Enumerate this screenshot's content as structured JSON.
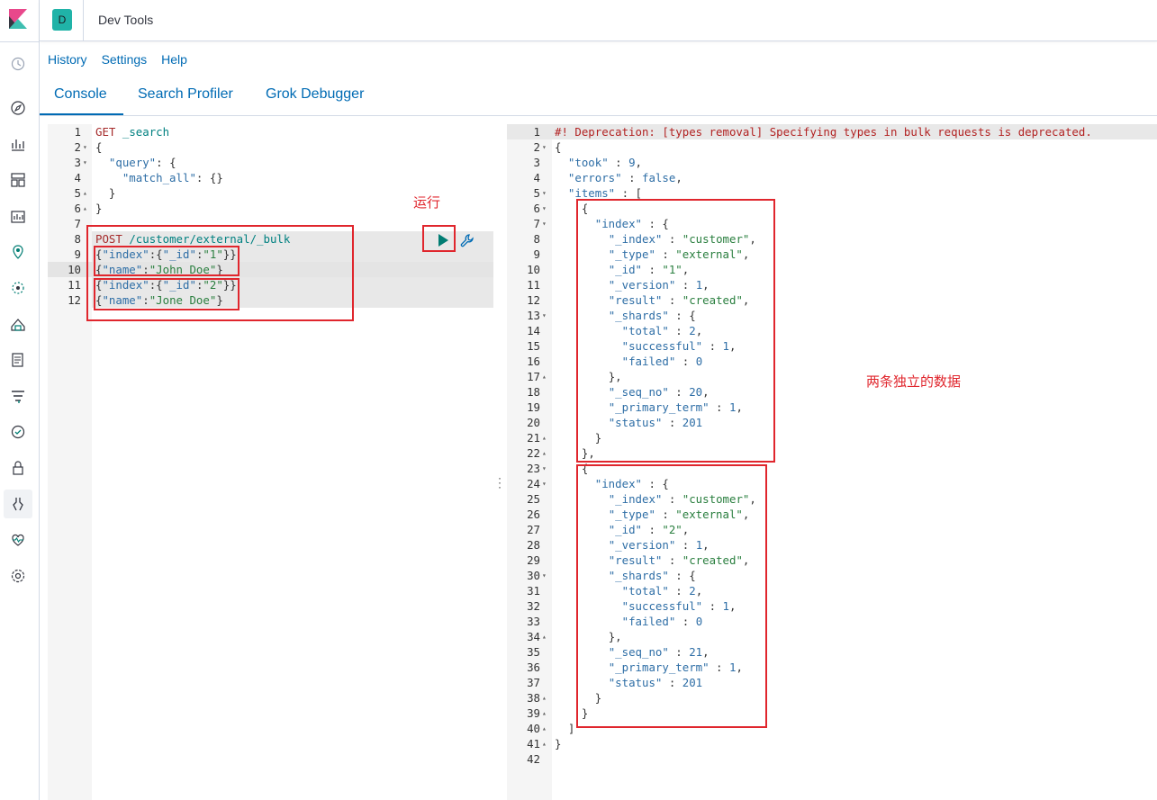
{
  "header": {
    "avatar_letter": "D",
    "title": "Dev Tools"
  },
  "toplinks": [
    "History",
    "Settings",
    "Help"
  ],
  "tabs": [
    "Console",
    "Search Profiler",
    "Grok Debugger"
  ],
  "annotations": {
    "run": "运行",
    "two_records": "两条独立的数据"
  },
  "sidebar_icons": [
    "recent-icon",
    "discover-icon",
    "visualize-icon",
    "dashboard-icon",
    "canvas-icon",
    "maps-icon",
    "ml-icon",
    "infrastructure-icon",
    "logs-icon",
    "apm-icon",
    "uptime-icon",
    "siem-icon",
    "dev-tools-icon",
    "monitoring-icon",
    "management-icon"
  ],
  "colors": {
    "accent": "#006bb4",
    "annotation": "#e0262d",
    "avatar": "#20b3a8"
  },
  "request_lines": [
    "GET _search",
    "{",
    "  \"query\": {",
    "    \"match_all\": {}",
    "  }",
    "}",
    "",
    "POST /customer/external/_bulk",
    "{\"index\":{\"_id\":\"1\"}}",
    "{\"name\":\"John Doe\"}",
    "{\"index\":{\"_id\":\"2\"}}",
    "{\"name\":\"Jone Doe\"}"
  ],
  "response_lines": [
    "#! Deprecation: [types removal] Specifying types in bulk requests is deprecated.",
    "{",
    "  \"took\" : 9,",
    "  \"errors\" : false,",
    "  \"items\" : [",
    "    {",
    "      \"index\" : {",
    "        \"_index\" : \"customer\",",
    "        \"_type\" : \"external\",",
    "        \"_id\" : \"1\",",
    "        \"_version\" : 1,",
    "        \"result\" : \"created\",",
    "        \"_shards\" : {",
    "          \"total\" : 2,",
    "          \"successful\" : 1,",
    "          \"failed\" : 0",
    "        },",
    "        \"_seq_no\" : 20,",
    "        \"_primary_term\" : 1,",
    "        \"status\" : 201",
    "      }",
    "    },",
    "    {",
    "      \"index\" : {",
    "        \"_index\" : \"customer\",",
    "        \"_type\" : \"external\",",
    "        \"_id\" : \"2\",",
    "        \"_version\" : 1,",
    "        \"result\" : \"created\",",
    "        \"_shards\" : {",
    "          \"total\" : 2,",
    "          \"successful\" : 1,",
    "          \"failed\" : 0",
    "        },",
    "        \"_seq_no\" : 21,",
    "        \"_primary_term\" : 1,",
    "        \"status\" : 201",
    "      }",
    "    }",
    "  ]",
    "}",
    ""
  ],
  "request_folds": {
    "2": "down",
    "3": "down",
    "5": "up",
    "6": "up"
  },
  "response_folds": {
    "2": "down",
    "5": "down",
    "6": "down",
    "7": "down",
    "13": "down",
    "17": "up",
    "21": "up",
    "22": "up",
    "23": "down",
    "24": "down",
    "30": "down",
    "34": "up",
    "38": "up",
    "39": "up",
    "40": "up",
    "41": "up"
  }
}
